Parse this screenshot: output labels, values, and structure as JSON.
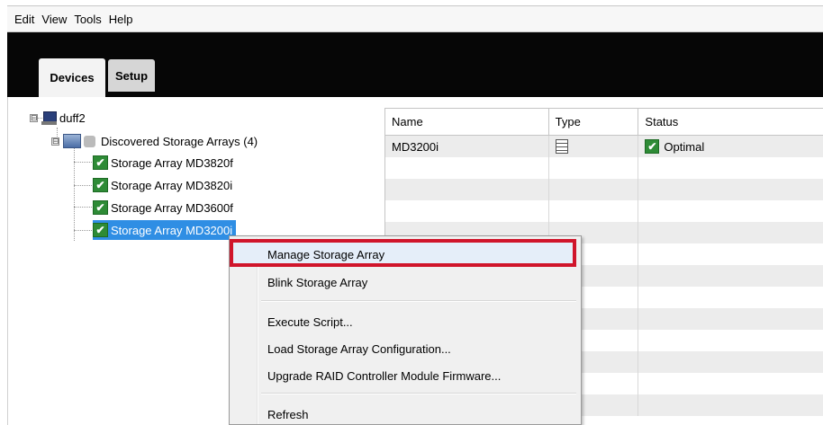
{
  "menubar": {
    "items": [
      "Edit",
      "View",
      "Tools",
      "Help"
    ]
  },
  "tabs": [
    {
      "label": "Devices",
      "active": true
    },
    {
      "label": "Setup",
      "active": false
    }
  ],
  "tree": {
    "root": {
      "label": "duff2",
      "expander": "⊟"
    },
    "group": {
      "label": "Discovered Storage Arrays (4)",
      "expander": "⊟"
    },
    "arrays": [
      {
        "label": "Storage Array MD3820f",
        "status": "optimal"
      },
      {
        "label": "Storage Array MD3820i",
        "status": "optimal"
      },
      {
        "label": "Storage Array MD3600f",
        "status": "optimal"
      },
      {
        "label": "Storage Array MD3200i",
        "status": "optimal",
        "selected": true
      }
    ],
    "check_glyph": "✔"
  },
  "table": {
    "columns": [
      "Name",
      "Type",
      "Status"
    ],
    "rows": [
      {
        "name": "MD3200i",
        "type_icon": "storage-array-icon",
        "status": "Optimal"
      }
    ]
  },
  "context_menu": {
    "items": [
      "Manage Storage Array",
      "Blink Storage Array",
      "Execute Script...",
      "Load Storage Array Configuration...",
      "Upgrade RAID Controller Module Firmware...",
      "Refresh"
    ],
    "highlighted": "Manage Storage Array"
  },
  "colors": {
    "selection": "#2f8ee4",
    "highlight_border": "#d0152b",
    "status_ok": "#2e8b36",
    "header_bg": "#060606"
  }
}
